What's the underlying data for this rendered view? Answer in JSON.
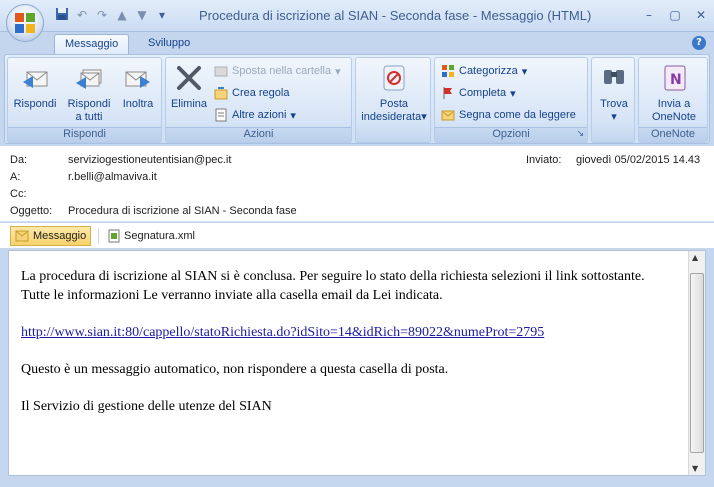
{
  "window": {
    "title": "Procedura di iscrizione al SIAN - Seconda fase - Messaggio (HTML)"
  },
  "tabs": [
    {
      "label": "Messaggio",
      "active": true
    },
    {
      "label": "Sviluppo",
      "active": false
    }
  ],
  "ribbon": {
    "rispondi": {
      "label": "Rispondi",
      "buttons": {
        "reply": "Rispondi",
        "reply_all_1": "Rispondi",
        "reply_all_2": "a tutti",
        "forward": "Inoltra"
      }
    },
    "azioni": {
      "label": "Azioni",
      "delete": "Elimina",
      "move": "Sposta nella cartella",
      "rule": "Crea regola",
      "other": "Altre azioni"
    },
    "junk": {
      "line1": "Posta",
      "line2": "indesiderata"
    },
    "opzioni": {
      "label": "Opzioni",
      "categorize": "Categorizza",
      "followup": "Completa",
      "mark_read": "Segna come da leggere"
    },
    "find": {
      "label": "Trova"
    },
    "onenote": {
      "label": "OneNote",
      "line1": "Invia a",
      "line2": "OneNote"
    }
  },
  "header": {
    "from_label": "Da:",
    "from": "serviziogestioneutentisian@pec.it",
    "to_label": "A:",
    "to": "r.belli@almaviva.it",
    "cc_label": "Cc:",
    "cc": "",
    "subject_label": "Oggetto:",
    "subject": "Procedura di iscrizione al SIAN - Seconda fase",
    "sent_label": "Inviato:",
    "sent": "giovedì 05/02/2015 14.43"
  },
  "attachments": [
    {
      "label": "Messaggio",
      "selected": true
    },
    {
      "label": "Segnatura.xml",
      "selected": false
    }
  ],
  "body": {
    "paragraph1": "La procedura di iscrizione al SIAN si è conclusa. Per seguire lo stato della richiesta selezioni il link sottostante. Tutte le informazioni Le verranno inviate alla casella email da Lei indicata.",
    "link": "http://www.sian.it:80/cappello/statoRichiesta.do?idSito=14&idRich=89022&numeProt=2795",
    "paragraph2": "Questo è un messaggio automatico, non rispondere a questa casella di posta.",
    "paragraph3": "Il Servizio di gestione delle utenze del SIAN"
  },
  "colors": {
    "accent": "#15428b",
    "link": "#1a1aa6",
    "ribbon": "#d6e4f6"
  }
}
